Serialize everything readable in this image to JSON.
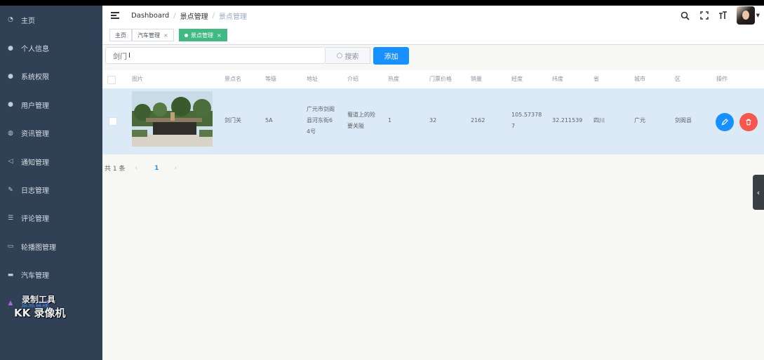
{
  "sidebar": {
    "items": [
      {
        "label": "主页",
        "icon": "dashboard-icon",
        "glyph": "◔"
      },
      {
        "label": "个人信息",
        "icon": "user-icon",
        "glyph": "●"
      },
      {
        "label": "系统权限",
        "icon": "user-lock-icon",
        "glyph": "●"
      },
      {
        "label": "用户管理",
        "icon": "users-icon",
        "glyph": "●"
      },
      {
        "label": "资讯管理",
        "icon": "globe-icon",
        "glyph": "◍"
      },
      {
        "label": "通知管理",
        "icon": "megaphone-icon",
        "glyph": "◁"
      },
      {
        "label": "日志管理",
        "icon": "feather-icon",
        "glyph": "✎"
      },
      {
        "label": "评论管理",
        "icon": "list-icon",
        "glyph": "☰"
      },
      {
        "label": "轮播图管理",
        "icon": "image-icon",
        "glyph": "▭"
      },
      {
        "label": "汽车管理",
        "icon": "car-icon",
        "glyph": "▬"
      },
      {
        "label": "景点管理",
        "icon": "mountain-icon",
        "glyph": "▲"
      }
    ]
  },
  "watermark": {
    "line1": "录制工具",
    "line2": "KK 录像机"
  },
  "navbar": {
    "breadcrumb": [
      "Dashboard",
      "景点管理",
      "景点管理"
    ]
  },
  "tags": [
    {
      "label": "主页"
    },
    {
      "label": "汽车管理"
    },
    {
      "label": "景点管理"
    }
  ],
  "search": {
    "value": "剑门",
    "button": "搜索"
  },
  "add_button": "添加",
  "table": {
    "headers": [
      "图片",
      "景点名",
      "等级",
      "地址",
      "介绍",
      "热度",
      "门票价格",
      "销量",
      "经度",
      "纬度",
      "省",
      "城市",
      "区",
      "操作"
    ],
    "rows": [
      {
        "name": "剑门关",
        "level": "5A",
        "address": [
          "广元市剑阁",
          "县河东街6",
          "4号"
        ],
        "intro": [
          "蜀道上的险",
          "要关隘"
        ],
        "hot": "1",
        "price": "32",
        "sales": "2162",
        "lng": [
          "105.57378",
          "7"
        ],
        "lat": "32.211539",
        "province": "四川",
        "city": "广元",
        "district": "剑阁县"
      }
    ]
  },
  "pagination": {
    "total": "共 1 条",
    "page": "1"
  }
}
